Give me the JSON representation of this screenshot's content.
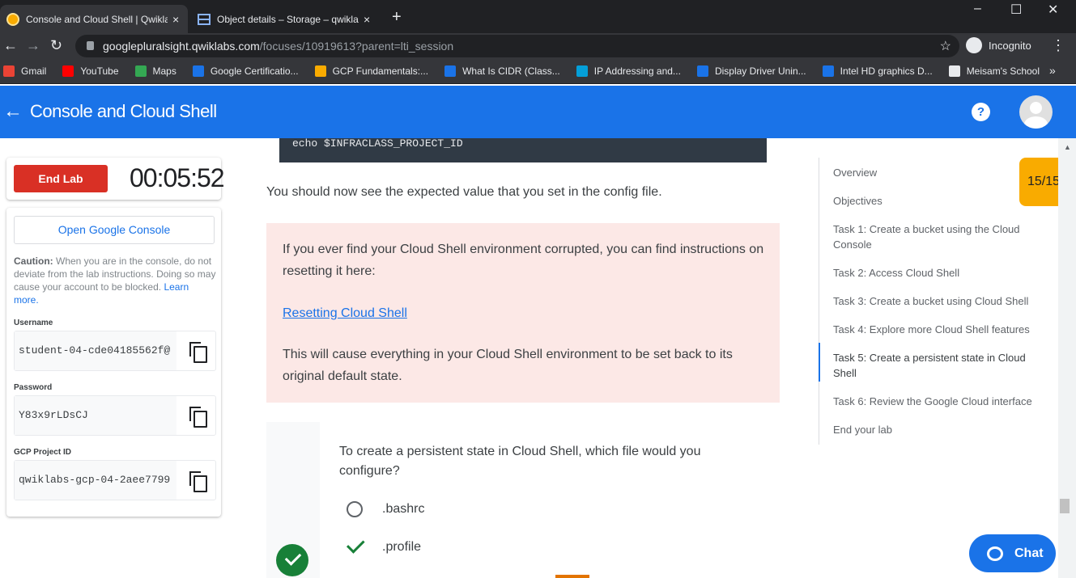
{
  "browser": {
    "tabs": [
      {
        "title": "Console and Cloud Shell | Qwiklabs",
        "active": true
      },
      {
        "title": "Object details – Storage – qwiklabs",
        "active": false
      }
    ],
    "close_glyph": "×",
    "newtab_glyph": "+",
    "window_controls": {
      "minimize": "–",
      "maximize": "☐",
      "close": "✕"
    },
    "nav": {
      "back": "←",
      "forward": "→",
      "reload": "↻"
    },
    "url_host": "googlepluralsight.qwiklabs.com",
    "url_path": "/focuses/10919613?parent=lti_session",
    "incognito_label": "Incognito",
    "more_glyph": "⋮",
    "star_glyph": "☆",
    "bookmarks": [
      {
        "label": "Gmail",
        "color": "#ea4335"
      },
      {
        "label": "YouTube",
        "color": "#ff0000"
      },
      {
        "label": "Maps",
        "color": "#34a853"
      },
      {
        "label": "Google Certificatio...",
        "color": "#1a73e8"
      },
      {
        "label": "GCP Fundamentals:...",
        "color": "#f9ab00"
      },
      {
        "label": "What Is CIDR (Class...",
        "color": "#1a73e8"
      },
      {
        "label": "IP Addressing and...",
        "color": "#049fd9"
      },
      {
        "label": "Display Driver Unin...",
        "color": "#1a73e8"
      },
      {
        "label": "Intel HD graphics D...",
        "color": "#1a73e8"
      },
      {
        "label": "Meisam's School",
        "color": "#e8eaed"
      }
    ],
    "bookmarks_overflow": "»"
  },
  "header": {
    "back_glyph": "←",
    "title": "Console and Cloud Shell",
    "help_glyph": "?"
  },
  "lab": {
    "end_lab_label": "End Lab",
    "timer": "00:05:52",
    "open_console_label": "Open Google Console",
    "caution_bold": "Caution:",
    "caution_text": " When you are in the console, do not deviate from the lab instructions. Doing so may cause your account to be blocked. ",
    "learn_more": "Learn more.",
    "username_label": "Username",
    "username": "student-04-cde04185562f@",
    "password_label": "Password",
    "password": "Y83x9rLDsCJ",
    "project_label": "GCP Project ID",
    "project_id": "qwiklabs-gcp-04-2aee7799"
  },
  "content": {
    "code": "echo $INFRACLASS_PROJECT_ID",
    "expected_text": "You should now see the expected value that you set in the config file.",
    "note_text": "If you ever find your Cloud Shell environment corrupted, you can find instructions on resetting it here:",
    "note_link": "Resetting Cloud Shell",
    "note_after": "This will cause everything in your Cloud Shell environment to be set back to its original default state.",
    "quiz_question": "To create a persistent state in Cloud Shell, which file would you configure?",
    "options": [
      ".bashrc",
      ".profile"
    ]
  },
  "toc": {
    "items": [
      "Overview",
      "Objectives",
      "Task 1: Create a bucket using the Cloud Console",
      "Task 2: Access Cloud Shell",
      "Task 3: Create a bucket using Cloud Shell",
      "Task 4: Explore more Cloud Shell features",
      "Task 5: Create a persistent state in Cloud Shell",
      "Task 6: Review the Google Cloud interface",
      "End your lab"
    ],
    "active_index": 6
  },
  "score": "15/15",
  "chat_label": "Chat",
  "colors": {
    "accent": "#1a73e8",
    "danger": "#d93025",
    "success": "#188038",
    "score": "#f9ab00"
  }
}
